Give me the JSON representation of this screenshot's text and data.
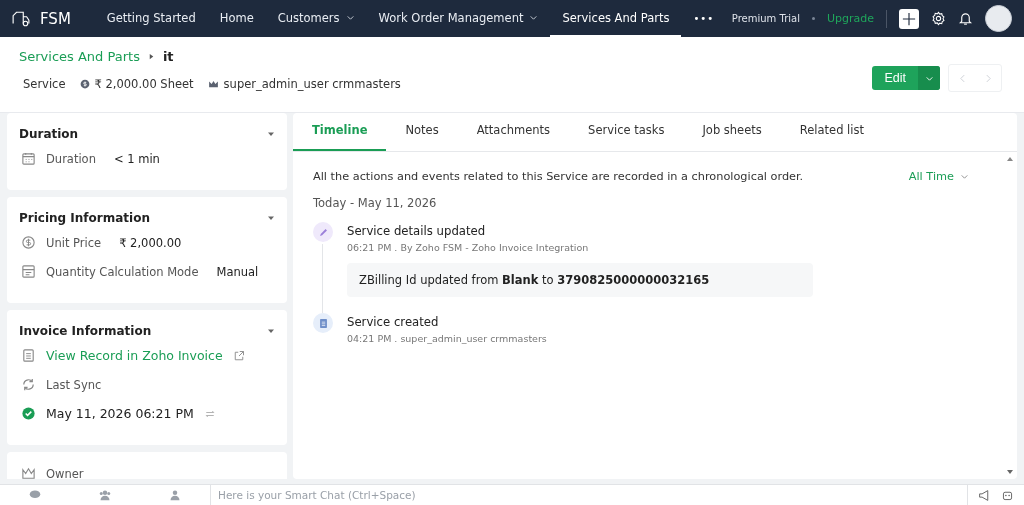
{
  "nav": {
    "logo": "FSM",
    "items": [
      {
        "label": "Getting Started",
        "dropdown": false,
        "selected": false
      },
      {
        "label": "Home",
        "dropdown": false,
        "selected": false
      },
      {
        "label": "Customers",
        "dropdown": true,
        "selected": false
      },
      {
        "label": "Work Order Management",
        "dropdown": true,
        "selected": false
      },
      {
        "label": "Services And Parts",
        "dropdown": false,
        "selected": true
      }
    ],
    "more": "•••",
    "trial": "Premium Trial",
    "upgrade": "Upgrade"
  },
  "header": {
    "breadcrumb": {
      "parent": "Services And Parts",
      "current": "it"
    },
    "meta": [
      {
        "kind": "text",
        "text": "Service"
      },
      {
        "kind": "price",
        "text": "₹ 2,000.00 Sheet"
      },
      {
        "kind": "owner",
        "text": "super_admin_user crmmasters"
      }
    ],
    "edit_button": "Edit"
  },
  "cards": [
    {
      "title": "Duration",
      "fields": [
        {
          "kind": "field",
          "label": "Duration",
          "value": "< 1 min"
        }
      ]
    },
    {
      "title": "Pricing Information",
      "fields": [
        {
          "kind": "field",
          "label": "Unit Price",
          "value": "₹ 2,000.00"
        },
        {
          "kind": "field",
          "label": "Quantity Calculation Mode",
          "value": "Manual"
        }
      ]
    },
    {
      "title": "Invoice Information",
      "fields": [
        {
          "kind": "link",
          "label": "View Record in Zoho Invoice"
        },
        {
          "kind": "field",
          "label": "Last Sync"
        },
        {
          "kind": "sync",
          "label": "May 11, 2026 06:21 PM"
        }
      ]
    },
    {
      "fields": [
        {
          "kind": "field",
          "label": "Owner"
        }
      ]
    }
  ],
  "timeline": {
    "tabs": [
      {
        "label": "Timeline",
        "selected": true
      },
      {
        "label": "Notes",
        "selected": false
      },
      {
        "label": "Attachments",
        "selected": false
      },
      {
        "label": "Service tasks",
        "selected": false
      },
      {
        "label": "Job sheets",
        "selected": false
      },
      {
        "label": "Related list",
        "selected": false
      }
    ],
    "description": "All the actions and events related to this Service are recorded in a chronological order.",
    "filter": "All Time",
    "date": "Today - May 11, 2026",
    "events": [
      {
        "kind": "edit",
        "title": "Service details updated",
        "meta": "06:21 PM . By Zoho FSM - Zoho Invoice Integration",
        "detail": "ZBilling Id updated from **Blank** to **3790825000000032165**"
      },
      {
        "kind": "create",
        "title": "Service created",
        "meta": "04:21 PM . super_admin_user crmmasters"
      }
    ]
  },
  "chat_bar": {
    "placeholder": "Here is your Smart Chat (Ctrl+Space)"
  }
}
